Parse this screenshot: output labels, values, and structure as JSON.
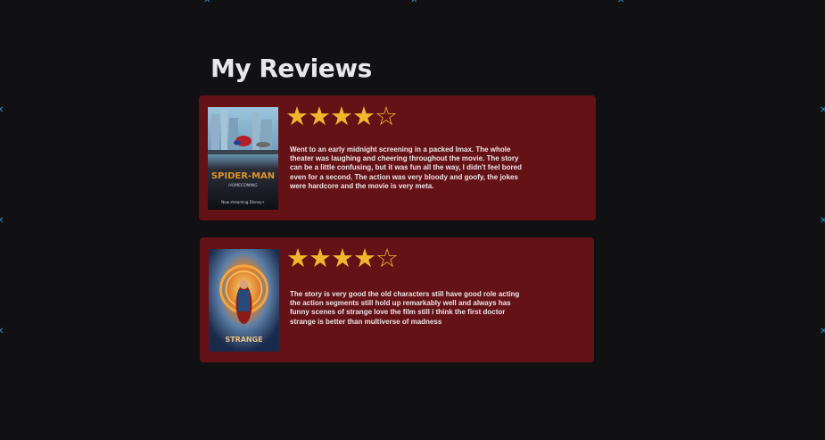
{
  "header": {
    "title": "My Reviews"
  },
  "reviews": [
    {
      "rating": 4,
      "max_rating": 5,
      "poster_title": "SPIDER-MAN",
      "poster_subtitle": "HOMECOMING",
      "poster_tagline": "Now streaming Disney+",
      "text": "Went to an early midnight screening in a packed Imax. The whole theater was laughing and cheering throughout the movie. The story can be a little confusing, but it was fun all the way, I didn't feel bored even for a second. The action was very bloody and goofy, the jokes were hardcore and the movie is very meta."
    },
    {
      "rating": 4,
      "max_rating": 5,
      "poster_title": "STRANGE",
      "text": "The story is very good the old characters still have good role acting the action segments still hold up remarkably well and always has funny scenes of strange love the film still i think the first doctor strange is better than multiverse of madness"
    }
  ],
  "colors": {
    "background": "#111114",
    "card": "#651217",
    "star": "#f1b62c",
    "title": "#e8e8ec"
  }
}
